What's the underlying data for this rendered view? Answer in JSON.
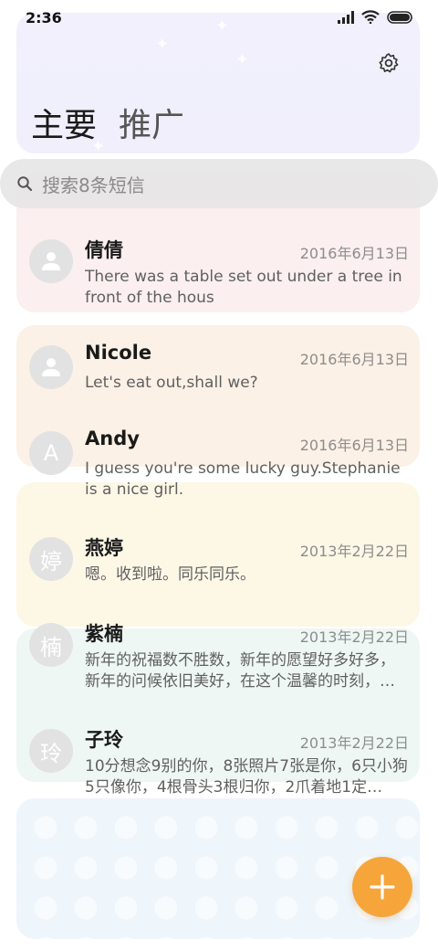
{
  "status_bar": {
    "time": "2:36"
  },
  "header": {
    "title_main": "主要",
    "title_promo": "推广"
  },
  "search": {
    "placeholder": "搜索8条短信"
  },
  "conversations": [
    {
      "name": "倩倩",
      "date": "2016年6月13日",
      "preview": "There was a table set out under a tree in front of the hous",
      "avatar_type": "person-icon"
    },
    {
      "name": "Nicole",
      "date": "2016年6月13日",
      "preview": "Let's eat out,shall we?",
      "avatar_type": "person-icon"
    },
    {
      "name": "Andy",
      "date": "2016年6月13日",
      "preview": "I guess you're some lucky guy.Stephanie is a nice girl.",
      "avatar_letter": "A"
    },
    {
      "name": "燕婷",
      "date": "2013年2月22日",
      "preview": "嗯。收到啦。同乐同乐。",
      "avatar_letter": "婷"
    },
    {
      "name": "紫楠",
      "date": "2013年2月22日",
      "preview": "新年的祝福数不胜数，新年的愿望好多好多，新年的问候依旧美好，在这个温馨的时刻，…",
      "avatar_letter": "楠"
    },
    {
      "name": "子玲",
      "date": "2013年2月22日",
      "preview": "10分想念9别的你，8张照片7张是你，6只小狗5只像你，4根骨头3根归你，2爪着地1定…",
      "avatar_letter": "玲"
    }
  ],
  "icons": {
    "settings": "gear-icon",
    "search": "search-icon",
    "fab": "plus-icon"
  },
  "colors": {
    "fab": "#f6a53a",
    "header_bg": "#f1f0fc",
    "card_pink": "#fbeff0",
    "card_peach": "#fcf1e6",
    "card_yellow": "#fdf7e6",
    "card_mint": "#eef7f4",
    "card_blue": "#eef5fb"
  }
}
